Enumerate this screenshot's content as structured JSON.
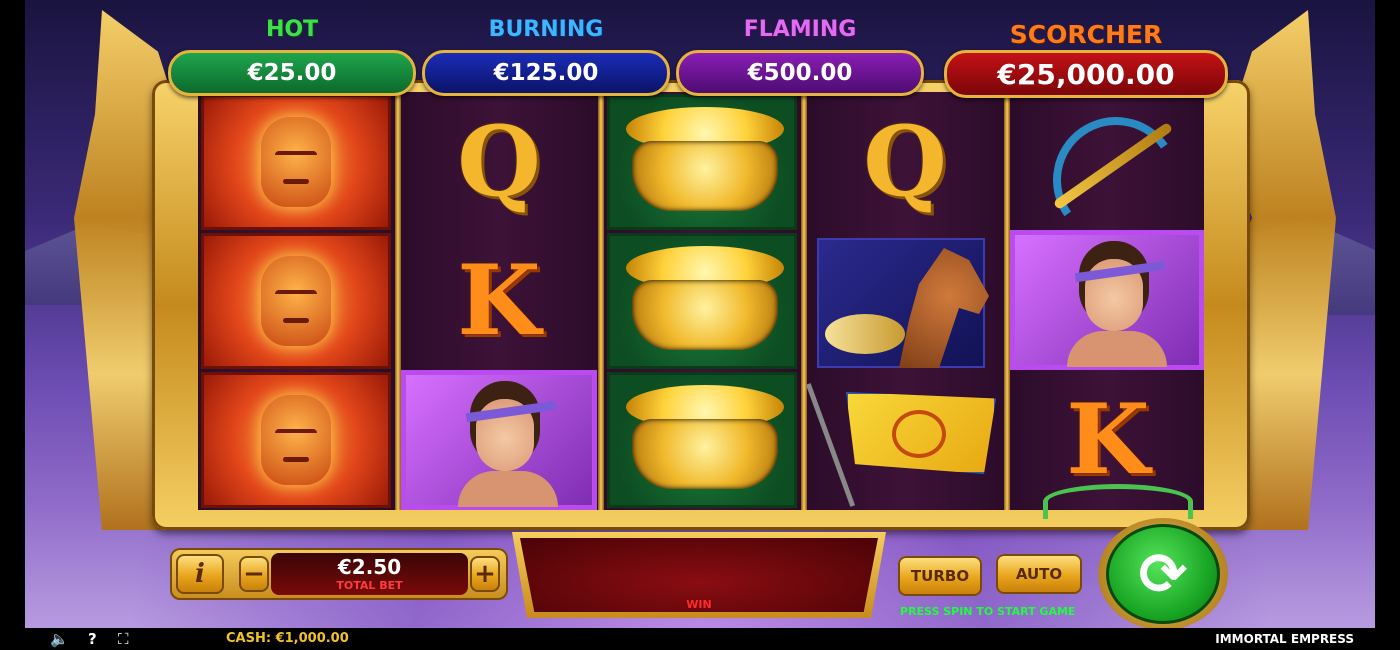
{
  "jackpots": {
    "hot": {
      "title": "HOT",
      "value": "€25.00",
      "color": "#3ee04a"
    },
    "burning": {
      "title": "BURNING",
      "value": "€125.00",
      "color": "#3bb6ff"
    },
    "flaming": {
      "title": "FLAMING",
      "value": "€500.00",
      "color": "#e16cf1"
    },
    "scorcher": {
      "title": "SCORCHER",
      "value": "€25,000.00",
      "color": "#ff7a18"
    }
  },
  "reels": [
    [
      "terracotta-warrior",
      "terracotta-warrior",
      "terracotta-warrior"
    ],
    [
      "Q",
      "K",
      "empress"
    ],
    [
      "gold-pot",
      "gold-pot",
      "gold-pot"
    ],
    [
      "Q",
      "horse",
      "flag"
    ],
    [
      "crossbow",
      "empress",
      "K"
    ]
  ],
  "controls": {
    "info_label": "i",
    "minus_label": "−",
    "plus_label": "+",
    "bet_value": "€2.50",
    "bet_label": "TOTAL BET",
    "win_label": "WIN",
    "turbo_label": "TURBO",
    "auto_label": "AUTO",
    "spin_glyph": "⟳",
    "press_hint": "PRESS SPIN TO START GAME"
  },
  "status": {
    "cash": "CASH:  €1,000.00",
    "game_name": "IMMORTAL EMPRESS",
    "sound_icon": "🔈",
    "help_icon": "?",
    "fullscreen_icon": "⛶"
  }
}
